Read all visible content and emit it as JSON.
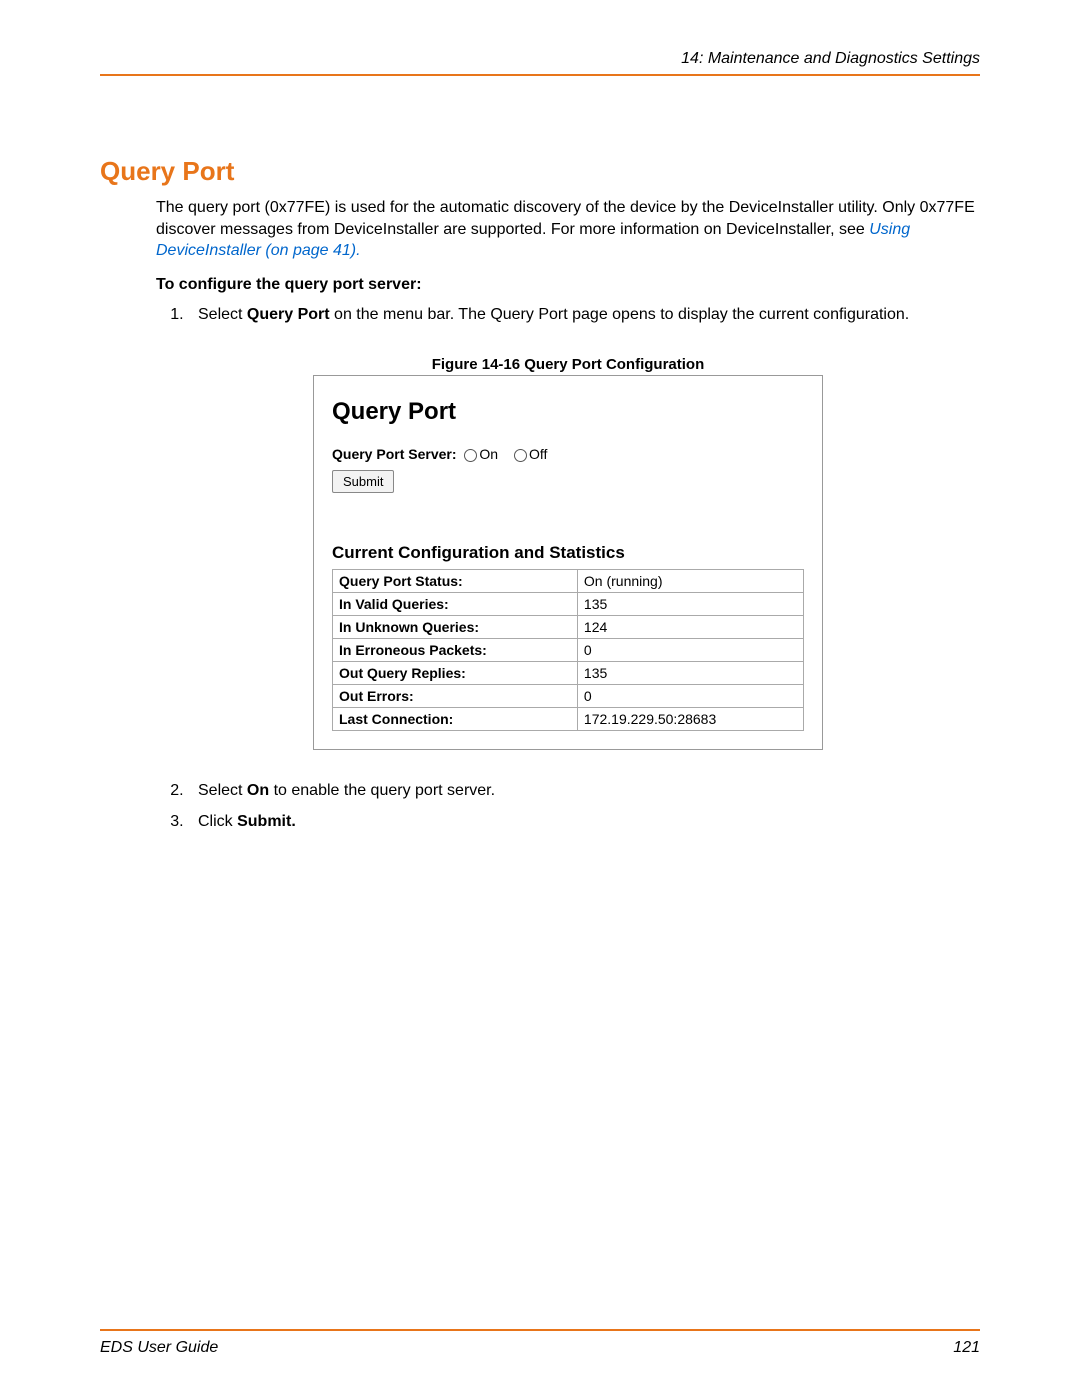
{
  "header": {
    "chapter": "14: Maintenance and Diagnostics Settings"
  },
  "section": {
    "title": "Query Port",
    "intro1": "The query port (0x77FE) is used for the automatic discovery of the device by the DeviceInstaller utility. Only 0x77FE discover messages from DeviceInstaller are supported. For more information on DeviceInstaller, see ",
    "intro_link": "Using DeviceInstaller (on page 41).",
    "subhead": "To configure the query port server:",
    "step1_prefix": "Select ",
    "step1_bold": "Query Port",
    "step1_suffix": " on the menu bar. The Query Port page opens to display the current configuration.",
    "step2_prefix": "Select ",
    "step2_bold": "On",
    "step2_suffix": " to enable the query port server.",
    "step3_prefix": "Click ",
    "step3_bold": "Submit."
  },
  "figure": {
    "caption": "Figure 14-16  Query Port Configuration",
    "title": "Query Port",
    "radio_label": "Query Port Server:",
    "radio_on": "On",
    "radio_off": "Off",
    "submit": "Submit",
    "stats_heading": "Current Configuration and Statistics",
    "rows": [
      {
        "k": "Query Port Status:",
        "v": "On (running)"
      },
      {
        "k": "In Valid Queries:",
        "v": "135"
      },
      {
        "k": "In Unknown Queries:",
        "v": "124"
      },
      {
        "k": "In Erroneous Packets:",
        "v": "0"
      },
      {
        "k": "Out Query Replies:",
        "v": "135"
      },
      {
        "k": "Out Errors:",
        "v": "0"
      },
      {
        "k": "Last Connection:",
        "v": "172.19.229.50:28683"
      }
    ]
  },
  "footer": {
    "title": "EDS User Guide",
    "page": "121"
  }
}
